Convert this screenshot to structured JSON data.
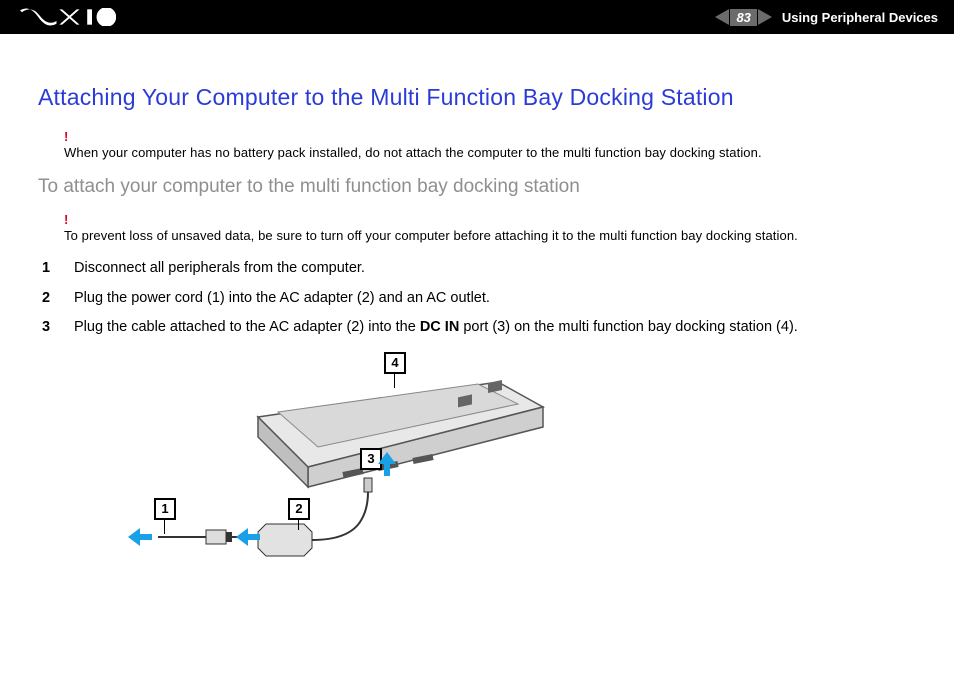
{
  "header": {
    "page_number": "83",
    "section": "Using Peripheral Devices"
  },
  "body": {
    "title": "Attaching Your Computer to the Multi Function Bay Docking Station",
    "warning1": "When your computer has no battery pack installed, do not attach the computer to the multi function bay docking station.",
    "subhead": "To attach your computer to the multi function bay docking station",
    "warning2": "To prevent loss of unsaved data, be sure to turn off your computer before attaching it to the multi function bay docking station.",
    "steps": [
      {
        "n": "1",
        "text": "Disconnect all peripherals from the computer."
      },
      {
        "n": "2",
        "text": "Plug the power cord (1) into the AC adapter (2) and an AC outlet."
      },
      {
        "n": "3",
        "pre": "Plug the cable attached to the AC adapter (2) into the ",
        "bold": "DC IN",
        "post": " port (3) on the multi function bay docking station (4)."
      }
    ],
    "callouts": {
      "c1": "1",
      "c2": "2",
      "c3": "3",
      "c4": "4"
    }
  }
}
